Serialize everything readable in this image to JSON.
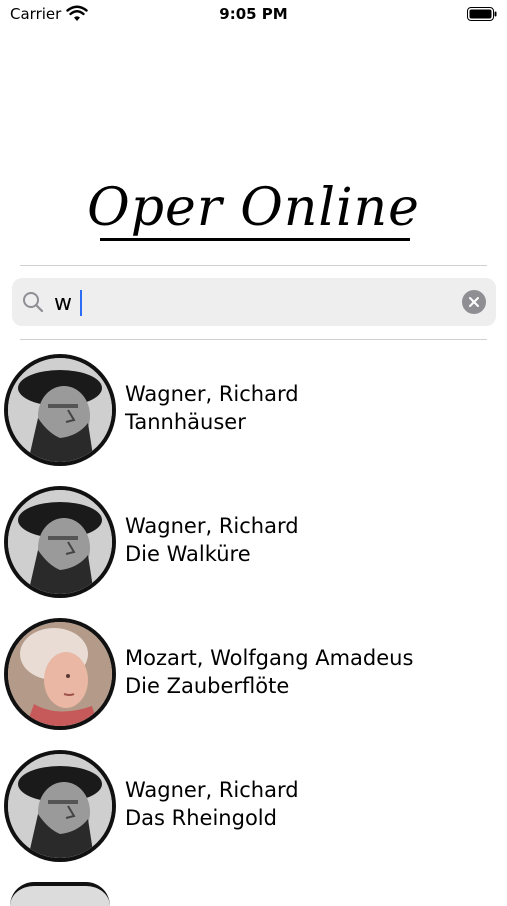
{
  "status_bar": {
    "carrier": "Carrier",
    "time": "9:05 PM"
  },
  "app": {
    "title": "Oper Online"
  },
  "search": {
    "value": "w",
    "placeholder": ""
  },
  "results": [
    {
      "composer": "Wagner, Richard",
      "opera": "Tannhäuser",
      "portrait": "wagner"
    },
    {
      "composer": "Wagner, Richard",
      "opera": "Die Walküre",
      "portrait": "wagner"
    },
    {
      "composer": "Mozart, Wolfgang Amadeus",
      "opera": "Die Zauberflöte",
      "portrait": "mozart"
    },
    {
      "composer": "Wagner, Richard",
      "opera": "Das Rheingold",
      "portrait": "wagner"
    }
  ],
  "colors": {
    "caret": "#2d6df6",
    "search_bg": "#eeeeef",
    "clear_button": "#8e8e93"
  }
}
